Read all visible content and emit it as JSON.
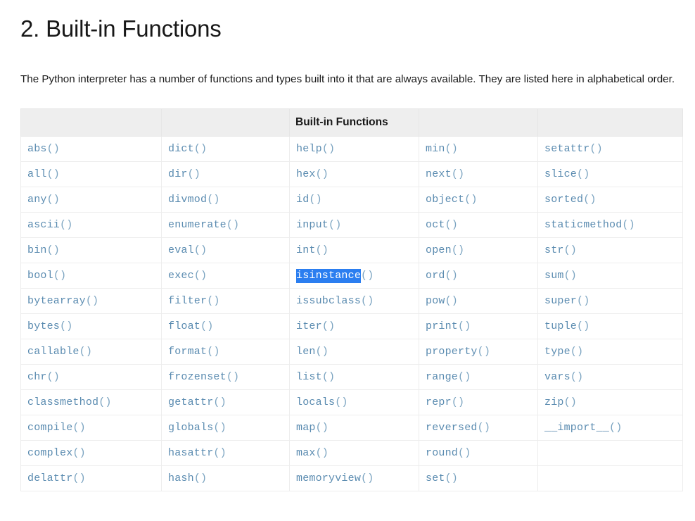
{
  "page": {
    "title": "2. Built-in Functions",
    "intro": "The Python interpreter has a number of functions and types built into it that are always available. They are listed here in alphabetical order."
  },
  "table": {
    "header_label": "Built-in Functions",
    "header_label_column_index": 2,
    "header_cells": [
      "",
      "",
      "Built-in Functions",
      "",
      ""
    ],
    "selection": {
      "text": "isinstance",
      "row": 5,
      "column": 2,
      "background_color": "#2b7ef0",
      "text_color": "#ffffff"
    },
    "colors": {
      "cell_text": "#5a8bb0",
      "header_background": "#eeeeee",
      "border": "#e6e6e6",
      "heading_text": "#181818"
    },
    "columns": [
      {
        "index": 0,
        "cells": [
          "abs()",
          "all()",
          "any()",
          "ascii()",
          "bin()",
          "bool()",
          "bytearray()",
          "bytes()",
          "callable()",
          "chr()",
          "classmethod()",
          "compile()",
          "complex()",
          "delattr()"
        ]
      },
      {
        "index": 1,
        "cells": [
          "dict()",
          "dir()",
          "divmod()",
          "enumerate()",
          "eval()",
          "exec()",
          "filter()",
          "float()",
          "format()",
          "frozenset()",
          "getattr()",
          "globals()",
          "hasattr()",
          "hash()"
        ]
      },
      {
        "index": 2,
        "cells": [
          "help()",
          "hex()",
          "id()",
          "input()",
          "int()",
          "isinstance()",
          "issubclass()",
          "iter()",
          "len()",
          "list()",
          "locals()",
          "map()",
          "max()",
          "memoryview()"
        ]
      },
      {
        "index": 3,
        "cells": [
          "min()",
          "next()",
          "object()",
          "oct()",
          "open()",
          "ord()",
          "pow()",
          "print()",
          "property()",
          "range()",
          "repr()",
          "reversed()",
          "round()",
          "set()"
        ]
      },
      {
        "index": 4,
        "cells": [
          "setattr()",
          "slice()",
          "sorted()",
          "staticmethod()",
          "str()",
          "sum()",
          "super()",
          "tuple()",
          "type()",
          "vars()",
          "zip()",
          "__import__()",
          "",
          ""
        ]
      }
    ]
  }
}
